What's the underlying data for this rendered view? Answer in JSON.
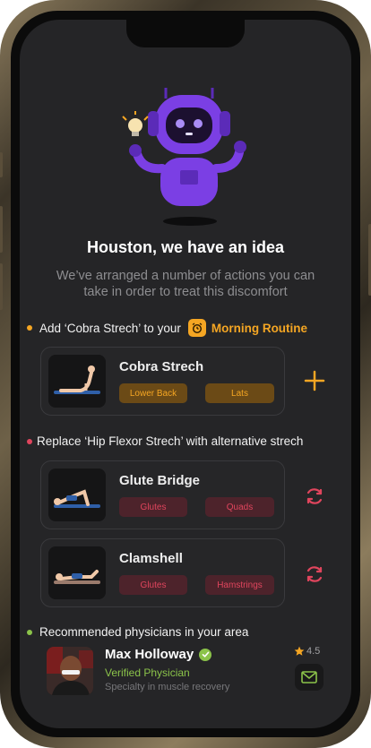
{
  "headline": "Houston, we have an idea",
  "subtitle": "We’ve arranged a number of actions you can take in order to treat this discomfort",
  "add_section": {
    "prefix": "Add ‘Cobra Strech’ to your",
    "routine_label": "Morning Routine",
    "dot_color": "#f5a623",
    "card": {
      "title": "Cobra Strech",
      "tags": [
        "Lower Back",
        "Lats"
      ],
      "action_icon": "plus-icon"
    }
  },
  "replace_section": {
    "title": "Replace ‘Hip Flexor Strech’ with alternative strech",
    "dot_color": "#e0455d",
    "cards": [
      {
        "title": "Glute Bridge",
        "tags": [
          "Glutes",
          "Quads"
        ],
        "action_icon": "swap-icon"
      },
      {
        "title": "Clamshell",
        "tags": [
          "Glutes",
          "Hamstrings"
        ],
        "action_icon": "swap-icon"
      }
    ]
  },
  "physicians_section": {
    "title": "Recommended physicians in your area",
    "dot_color": "#8bc34a",
    "physician": {
      "name": "Max Holloway",
      "role": "Verified Physician",
      "specialty": "Specialty in muscle recovery",
      "rating": "4.5"
    }
  },
  "colors": {
    "accent_orange": "#f5a623",
    "accent_red": "#e0455d",
    "accent_green": "#8bc34a",
    "robot_purple": "#7b3fe4"
  }
}
